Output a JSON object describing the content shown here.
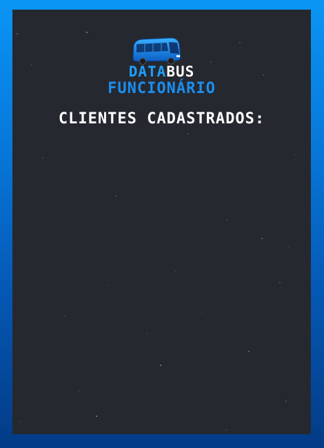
{
  "brand": {
    "line1_part1": "DATA",
    "line1_part2": "BUS",
    "line2": "FUNCIONÁRIO"
  },
  "heading": "CLIENTES CADASTRADOS:",
  "colors": {
    "frame_top": "#0a95f5",
    "frame_bottom": "#033b86",
    "panel": "#262830",
    "brand_blue": "#1ea0ff",
    "text_white": "#ffffff"
  },
  "icons": [
    "bus-icon"
  ]
}
